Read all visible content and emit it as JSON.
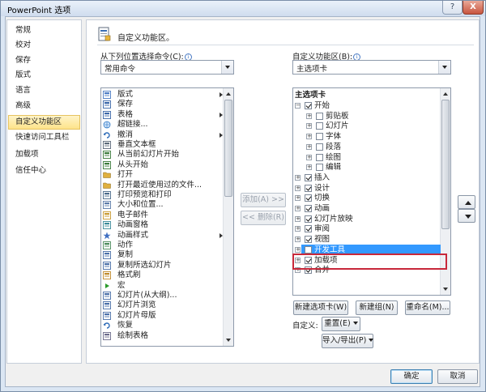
{
  "window": {
    "title": "PowerPoint 选项",
    "help_glyph": "?",
    "close_glyph": "X"
  },
  "nav": {
    "items": [
      {
        "label": "常规",
        "active": false
      },
      {
        "label": "校对",
        "active": false
      },
      {
        "label": "保存",
        "active": false
      },
      {
        "label": "版式",
        "active": false
      },
      {
        "label": "语言",
        "active": false
      },
      {
        "label": "高级",
        "active": false
      },
      {
        "label": "自定义功能区",
        "active": true
      },
      {
        "label": "快速访问工具栏",
        "active": false
      },
      {
        "label": "加载项",
        "active": false
      },
      {
        "label": "信任中心",
        "active": false
      }
    ]
  },
  "header": {
    "title": "自定义功能区。",
    "icon": "customize-ribbon-icon"
  },
  "left": {
    "label": "从下列位置选择命令(C):",
    "info_glyph": "i",
    "combo_value": "常用命令",
    "commands": [
      {
        "label": "版式",
        "icon": "layout-icon",
        "submenu": true
      },
      {
        "label": "保存",
        "icon": "save-icon",
        "submenu": false
      },
      {
        "label": "表格",
        "icon": "table-icon",
        "submenu": true
      },
      {
        "label": "超链接...",
        "icon": "hyperlink-icon",
        "submenu": false
      },
      {
        "label": "撤消",
        "icon": "undo-icon",
        "submenu": true
      },
      {
        "label": "垂直文本框",
        "icon": "vertical-textbox-icon",
        "submenu": false
      },
      {
        "label": "从当前幻灯片开始",
        "icon": "play-current-icon",
        "submenu": false
      },
      {
        "label": "从头开始",
        "icon": "play-start-icon",
        "submenu": false
      },
      {
        "label": "打开",
        "icon": "open-folder-icon",
        "submenu": false
      },
      {
        "label": "打开最近使用过的文件...",
        "icon": "recent-file-icon",
        "submenu": false
      },
      {
        "label": "打印预览和打印",
        "icon": "print-preview-icon",
        "submenu": false
      },
      {
        "label": "大小和位置...",
        "icon": "size-position-icon",
        "submenu": false
      },
      {
        "label": "电子邮件",
        "icon": "email-icon",
        "submenu": false
      },
      {
        "label": "动画窗格",
        "icon": "animation-pane-icon",
        "submenu": false
      },
      {
        "label": "动画样式",
        "icon": "animation-style-icon",
        "submenu": true
      },
      {
        "label": "动作",
        "icon": "action-icon",
        "submenu": false
      },
      {
        "label": "复制",
        "icon": "copy-icon",
        "submenu": false
      },
      {
        "label": "复制所选幻灯片",
        "icon": "duplicate-slide-icon",
        "submenu": false
      },
      {
        "label": "格式刷",
        "icon": "format-painter-icon",
        "submenu": false
      },
      {
        "label": "宏",
        "icon": "macro-icon",
        "submenu": false
      },
      {
        "label": "幻灯片(从大纲)...",
        "icon": "slides-from-outline-icon",
        "submenu": false
      },
      {
        "label": "幻灯片浏览",
        "icon": "slide-sorter-icon",
        "submenu": false
      },
      {
        "label": "幻灯片母版",
        "icon": "slide-master-icon",
        "submenu": false
      },
      {
        "label": "恢复",
        "icon": "redo-icon",
        "submenu": false
      },
      {
        "label": "绘制表格",
        "icon": "draw-table-icon",
        "submenu": false
      }
    ]
  },
  "middle": {
    "add_label": "添加(A) >>",
    "remove_label": "<< 删除(R)"
  },
  "right": {
    "label": "自定义功能区(B):",
    "info_glyph": "i",
    "combo_value": "主选项卡",
    "tree_header": "主选项卡",
    "tree": [
      {
        "label": "开始",
        "level": 0,
        "expander": "−",
        "checked": true,
        "selected": false
      },
      {
        "label": "剪贴板",
        "level": 1,
        "expander": "+",
        "checked": false,
        "selected": false
      },
      {
        "label": "幻灯片",
        "level": 1,
        "expander": "+",
        "checked": false,
        "selected": false
      },
      {
        "label": "字体",
        "level": 1,
        "expander": "+",
        "checked": false,
        "selected": false
      },
      {
        "label": "段落",
        "level": 1,
        "expander": "+",
        "checked": false,
        "selected": false
      },
      {
        "label": "绘图",
        "level": 1,
        "expander": "+",
        "checked": false,
        "selected": false
      },
      {
        "label": "编辑",
        "level": 1,
        "expander": "+",
        "checked": false,
        "selected": false
      },
      {
        "label": "插入",
        "level": 0,
        "expander": "+",
        "checked": true,
        "selected": false
      },
      {
        "label": "设计",
        "level": 0,
        "expander": "+",
        "checked": true,
        "selected": false
      },
      {
        "label": "切换",
        "level": 0,
        "expander": "+",
        "checked": true,
        "selected": false
      },
      {
        "label": "动画",
        "level": 0,
        "expander": "+",
        "checked": true,
        "selected": false
      },
      {
        "label": "幻灯片放映",
        "level": 0,
        "expander": "+",
        "checked": true,
        "selected": false
      },
      {
        "label": "审阅",
        "level": 0,
        "expander": "+",
        "checked": true,
        "selected": false
      },
      {
        "label": "视图",
        "level": 0,
        "expander": "+",
        "checked": true,
        "selected": false
      },
      {
        "label": "开发工具",
        "level": 0,
        "expander": "+",
        "checked": false,
        "selected": true
      },
      {
        "label": "加载项",
        "level": 0,
        "expander": "+",
        "checked": true,
        "selected": false
      },
      {
        "label": "合并",
        "level": 0,
        "expander": "+",
        "checked": true,
        "selected": false
      }
    ],
    "new_tab_label": "新建选项卡(W)",
    "new_group_label": "新建组(N)",
    "rename_label": "重命名(M)...",
    "customize_label": "自定义:",
    "reset_label": "重置(E)",
    "import_export_label": "导入/导出(P)"
  },
  "footer": {
    "ok_label": "确定",
    "cancel_label": "取消"
  },
  "colors": {
    "selection": "#3399ff",
    "nav_active": "#fde38a",
    "highlight_box": "#c8283a"
  }
}
